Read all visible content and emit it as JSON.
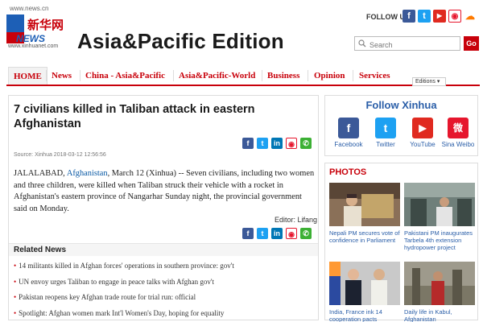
{
  "header": {
    "site_url": "www.news.cn",
    "logo_news": "NEWS",
    "logo_cn": "新华网",
    "logo_sub": "www.xinhuanet.com",
    "edition": "Asia&Pacific Edition",
    "follow_us": "FOLLOW US",
    "search_placeholder": "Search",
    "go_label": "Go"
  },
  "nav": {
    "items": [
      "HOME",
      "News",
      "China - Asia&Pacific",
      "Asia&Pacific-World",
      "Business",
      "Opinion",
      "Services"
    ],
    "editions_label": "Editions ▾"
  },
  "article": {
    "headline": "7 civilians killed in Taliban attack in eastern Afghanistan",
    "source": "Source: Xinhua   2018-03-12 12:56:56",
    "body_pre": "JALALABAD, ",
    "body_link": "Afghanistan",
    "body_post": ", March 12 (Xinhua) -- Seven civilians, including two women and three children, were killed when Taliban struck their vehicle with a rocket in Afghanistan's eastern province of Nangarhar Sunday night, the provincial government said on Monday.",
    "editor": "Editor: Lifang"
  },
  "related": {
    "title": "Related News",
    "items": [
      "14 militants killed in Afghan forces' operations in southern province: gov't",
      "UN envoy urges Taliban to engage in peace talks with Afghan gov't",
      "Pakistan reopens key Afghan trade route for trial run: official",
      "Spotlight: Afghan women mark Int'l Women's Day, hoping for equality"
    ]
  },
  "follow": {
    "title": "Follow Xinhua",
    "items": [
      {
        "label": "Facebook",
        "glyph": "f",
        "color": "#3b5998"
      },
      {
        "label": "Twitter",
        "glyph": "t",
        "color": "#1da1f2"
      },
      {
        "label": "YouTube",
        "glyph": "▶",
        "color": "#e02a20"
      },
      {
        "label": "Sina Weibo",
        "glyph": "微",
        "color": "#e6162d"
      }
    ]
  },
  "photos": {
    "title": "PHOTOS",
    "items": [
      {
        "caption": "Nepali PM secures vote of confidence in Parliament"
      },
      {
        "caption": "Pakistani PM inaugurates Tarbela 4th extension hydropower project"
      },
      {
        "caption": "India, France ink 14 cooperation pacts"
      },
      {
        "caption": "Daily life in Kabul, Afghanistan"
      }
    ]
  },
  "colors": {
    "brand_red": "#c8000a",
    "link_blue": "#2a5ea8"
  }
}
